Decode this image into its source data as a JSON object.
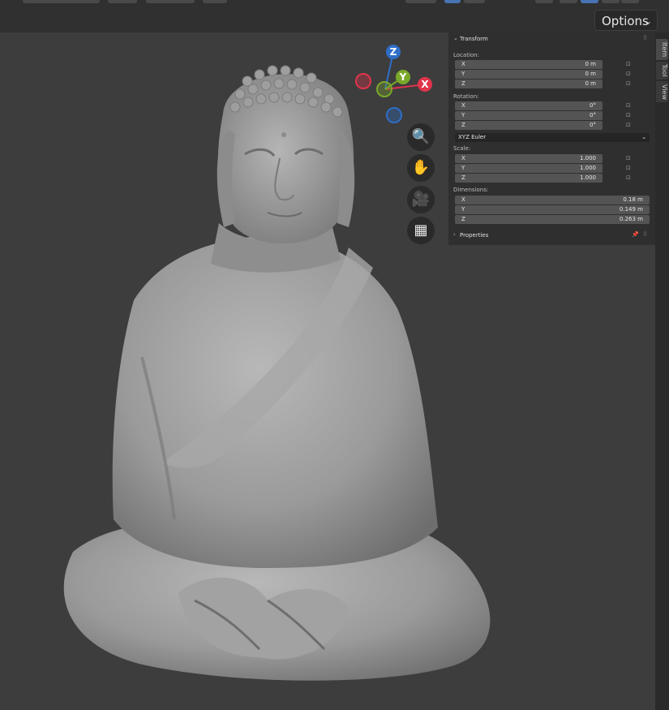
{
  "header": {
    "options_label": "Options",
    "options_chevron": "⌄"
  },
  "gizmo": {
    "z_label": "Z",
    "y_label": "Y",
    "x_label": "X",
    "colors": {
      "x": "#e0344b",
      "y": "#7aa82b",
      "z": "#2e6ec7"
    }
  },
  "nav_buttons": [
    {
      "icon": "zoom-icon",
      "glyph": "🔍"
    },
    {
      "icon": "hand-pan-icon",
      "glyph": "✋"
    },
    {
      "icon": "camera-icon",
      "glyph": "🎥"
    },
    {
      "icon": "grid-icon",
      "glyph": "▦"
    }
  ],
  "side_tabs": [
    "Item",
    "Tool",
    "View"
  ],
  "panel": {
    "transform_title": "Transform",
    "location_label": "Location:",
    "location": [
      {
        "axis": "X",
        "value": "0 m"
      },
      {
        "axis": "Y",
        "value": "0 m"
      },
      {
        "axis": "Z",
        "value": "0 m"
      }
    ],
    "rotation_label": "Rotation:",
    "rotation": [
      {
        "axis": "X",
        "value": "0°"
      },
      {
        "axis": "Y",
        "value": "0°"
      },
      {
        "axis": "Z",
        "value": "0°"
      }
    ],
    "rotation_mode": "XYZ Euler",
    "scale_label": "Scale:",
    "scale": [
      {
        "axis": "X",
        "value": "1.000"
      },
      {
        "axis": "Y",
        "value": "1.000"
      },
      {
        "axis": "Z",
        "value": "1.000"
      }
    ],
    "dimensions_label": "Dimensions:",
    "dimensions": [
      {
        "axis": "X",
        "value": "0.18 m"
      },
      {
        "axis": "Y",
        "value": "0.149 m"
      },
      {
        "axis": "Z",
        "value": "0.263 m"
      }
    ],
    "properties_title": "Properties"
  }
}
